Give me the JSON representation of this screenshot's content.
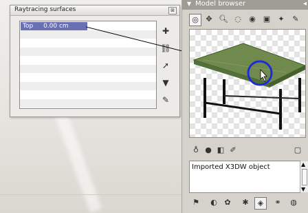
{
  "window_title": "Raytracing surfaces",
  "surfaces": {
    "rows": 10,
    "selected": {
      "name": "Top",
      "value": "0.00 cm"
    },
    "tools": [
      "add-icon",
      "link-icon",
      "select-arrow-icon",
      "filter-icon",
      "stamp-icon"
    ]
  },
  "model_browser": {
    "title": "Model browser",
    "toolbar": [
      "camera-icon",
      "move-icon",
      "zoom-icon",
      "rotate-icon",
      "target-icon",
      "picture-icon",
      "puzzle-icon",
      "stamp-icon"
    ],
    "preview_toolbar": [
      "bulb-icon",
      "sphere-icon",
      "material-icon",
      "edit-icon",
      "square-icon"
    ],
    "description": "Imported X3DW object",
    "bottom_toolbar": [
      "flag-icon",
      "circle-icon",
      "settings-icon",
      "render-icon",
      "object-icon",
      "link-icon",
      "globe-icon"
    ]
  },
  "colors": {
    "selection": "#6b6fb3",
    "table_top": "#6f8a4c",
    "highlight_circle": "#1e2bd6"
  }
}
